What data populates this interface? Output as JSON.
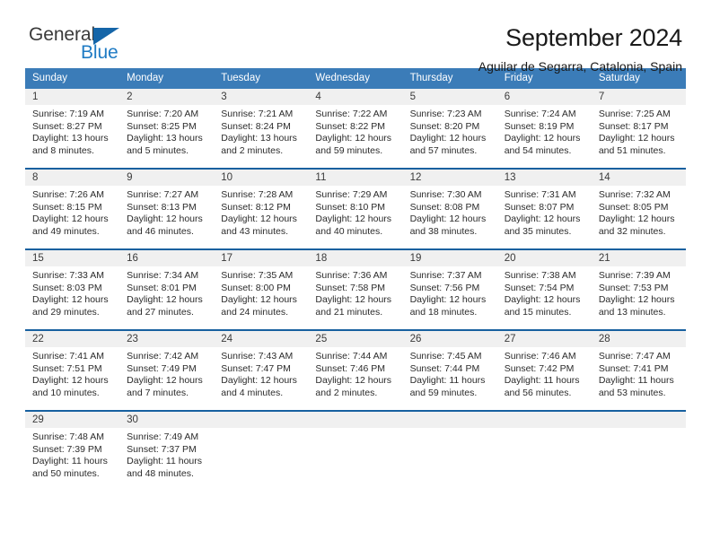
{
  "brand": {
    "name_part1": "General",
    "name_part2": "Blue",
    "triangle_color": "#1565a8",
    "blue_color": "#1f7bc4"
  },
  "header": {
    "title": "September 2024",
    "subtitle": "Aguilar de Segarra, Catalonia, Spain"
  },
  "theme": {
    "header_row_bg": "#3b7cb8",
    "week_rule": "#17609f",
    "daynum_bg": "#f0f0f0"
  },
  "weekdays": [
    "Sunday",
    "Monday",
    "Tuesday",
    "Wednesday",
    "Thursday",
    "Friday",
    "Saturday"
  ],
  "weeks": [
    [
      {
        "day": "1",
        "sunrise": "Sunrise: 7:19 AM",
        "sunset": "Sunset: 8:27 PM",
        "daylight1": "Daylight: 13 hours",
        "daylight2": "and 8 minutes."
      },
      {
        "day": "2",
        "sunrise": "Sunrise: 7:20 AM",
        "sunset": "Sunset: 8:25 PM",
        "daylight1": "Daylight: 13 hours",
        "daylight2": "and 5 minutes."
      },
      {
        "day": "3",
        "sunrise": "Sunrise: 7:21 AM",
        "sunset": "Sunset: 8:24 PM",
        "daylight1": "Daylight: 13 hours",
        "daylight2": "and 2 minutes."
      },
      {
        "day": "4",
        "sunrise": "Sunrise: 7:22 AM",
        "sunset": "Sunset: 8:22 PM",
        "daylight1": "Daylight: 12 hours",
        "daylight2": "and 59 minutes."
      },
      {
        "day": "5",
        "sunrise": "Sunrise: 7:23 AM",
        "sunset": "Sunset: 8:20 PM",
        "daylight1": "Daylight: 12 hours",
        "daylight2": "and 57 minutes."
      },
      {
        "day": "6",
        "sunrise": "Sunrise: 7:24 AM",
        "sunset": "Sunset: 8:19 PM",
        "daylight1": "Daylight: 12 hours",
        "daylight2": "and 54 minutes."
      },
      {
        "day": "7",
        "sunrise": "Sunrise: 7:25 AM",
        "sunset": "Sunset: 8:17 PM",
        "daylight1": "Daylight: 12 hours",
        "daylight2": "and 51 minutes."
      }
    ],
    [
      {
        "day": "8",
        "sunrise": "Sunrise: 7:26 AM",
        "sunset": "Sunset: 8:15 PM",
        "daylight1": "Daylight: 12 hours",
        "daylight2": "and 49 minutes."
      },
      {
        "day": "9",
        "sunrise": "Sunrise: 7:27 AM",
        "sunset": "Sunset: 8:13 PM",
        "daylight1": "Daylight: 12 hours",
        "daylight2": "and 46 minutes."
      },
      {
        "day": "10",
        "sunrise": "Sunrise: 7:28 AM",
        "sunset": "Sunset: 8:12 PM",
        "daylight1": "Daylight: 12 hours",
        "daylight2": "and 43 minutes."
      },
      {
        "day": "11",
        "sunrise": "Sunrise: 7:29 AM",
        "sunset": "Sunset: 8:10 PM",
        "daylight1": "Daylight: 12 hours",
        "daylight2": "and 40 minutes."
      },
      {
        "day": "12",
        "sunrise": "Sunrise: 7:30 AM",
        "sunset": "Sunset: 8:08 PM",
        "daylight1": "Daylight: 12 hours",
        "daylight2": "and 38 minutes."
      },
      {
        "day": "13",
        "sunrise": "Sunrise: 7:31 AM",
        "sunset": "Sunset: 8:07 PM",
        "daylight1": "Daylight: 12 hours",
        "daylight2": "and 35 minutes."
      },
      {
        "day": "14",
        "sunrise": "Sunrise: 7:32 AM",
        "sunset": "Sunset: 8:05 PM",
        "daylight1": "Daylight: 12 hours",
        "daylight2": "and 32 minutes."
      }
    ],
    [
      {
        "day": "15",
        "sunrise": "Sunrise: 7:33 AM",
        "sunset": "Sunset: 8:03 PM",
        "daylight1": "Daylight: 12 hours",
        "daylight2": "and 29 minutes."
      },
      {
        "day": "16",
        "sunrise": "Sunrise: 7:34 AM",
        "sunset": "Sunset: 8:01 PM",
        "daylight1": "Daylight: 12 hours",
        "daylight2": "and 27 minutes."
      },
      {
        "day": "17",
        "sunrise": "Sunrise: 7:35 AM",
        "sunset": "Sunset: 8:00 PM",
        "daylight1": "Daylight: 12 hours",
        "daylight2": "and 24 minutes."
      },
      {
        "day": "18",
        "sunrise": "Sunrise: 7:36 AM",
        "sunset": "Sunset: 7:58 PM",
        "daylight1": "Daylight: 12 hours",
        "daylight2": "and 21 minutes."
      },
      {
        "day": "19",
        "sunrise": "Sunrise: 7:37 AM",
        "sunset": "Sunset: 7:56 PM",
        "daylight1": "Daylight: 12 hours",
        "daylight2": "and 18 minutes."
      },
      {
        "day": "20",
        "sunrise": "Sunrise: 7:38 AM",
        "sunset": "Sunset: 7:54 PM",
        "daylight1": "Daylight: 12 hours",
        "daylight2": "and 15 minutes."
      },
      {
        "day": "21",
        "sunrise": "Sunrise: 7:39 AM",
        "sunset": "Sunset: 7:53 PM",
        "daylight1": "Daylight: 12 hours",
        "daylight2": "and 13 minutes."
      }
    ],
    [
      {
        "day": "22",
        "sunrise": "Sunrise: 7:41 AM",
        "sunset": "Sunset: 7:51 PM",
        "daylight1": "Daylight: 12 hours",
        "daylight2": "and 10 minutes."
      },
      {
        "day": "23",
        "sunrise": "Sunrise: 7:42 AM",
        "sunset": "Sunset: 7:49 PM",
        "daylight1": "Daylight: 12 hours",
        "daylight2": "and 7 minutes."
      },
      {
        "day": "24",
        "sunrise": "Sunrise: 7:43 AM",
        "sunset": "Sunset: 7:47 PM",
        "daylight1": "Daylight: 12 hours",
        "daylight2": "and 4 minutes."
      },
      {
        "day": "25",
        "sunrise": "Sunrise: 7:44 AM",
        "sunset": "Sunset: 7:46 PM",
        "daylight1": "Daylight: 12 hours",
        "daylight2": "and 2 minutes."
      },
      {
        "day": "26",
        "sunrise": "Sunrise: 7:45 AM",
        "sunset": "Sunset: 7:44 PM",
        "daylight1": "Daylight: 11 hours",
        "daylight2": "and 59 minutes."
      },
      {
        "day": "27",
        "sunrise": "Sunrise: 7:46 AM",
        "sunset": "Sunset: 7:42 PM",
        "daylight1": "Daylight: 11 hours",
        "daylight2": "and 56 minutes."
      },
      {
        "day": "28",
        "sunrise": "Sunrise: 7:47 AM",
        "sunset": "Sunset: 7:41 PM",
        "daylight1": "Daylight: 11 hours",
        "daylight2": "and 53 minutes."
      }
    ],
    [
      {
        "day": "29",
        "sunrise": "Sunrise: 7:48 AM",
        "sunset": "Sunset: 7:39 PM",
        "daylight1": "Daylight: 11 hours",
        "daylight2": "and 50 minutes."
      },
      {
        "day": "30",
        "sunrise": "Sunrise: 7:49 AM",
        "sunset": "Sunset: 7:37 PM",
        "daylight1": "Daylight: 11 hours",
        "daylight2": "and 48 minutes."
      },
      {
        "day": "",
        "sunrise": "",
        "sunset": "",
        "daylight1": "",
        "daylight2": ""
      },
      {
        "day": "",
        "sunrise": "",
        "sunset": "",
        "daylight1": "",
        "daylight2": ""
      },
      {
        "day": "",
        "sunrise": "",
        "sunset": "",
        "daylight1": "",
        "daylight2": ""
      },
      {
        "day": "",
        "sunrise": "",
        "sunset": "",
        "daylight1": "",
        "daylight2": ""
      },
      {
        "day": "",
        "sunrise": "",
        "sunset": "",
        "daylight1": "",
        "daylight2": ""
      }
    ]
  ]
}
